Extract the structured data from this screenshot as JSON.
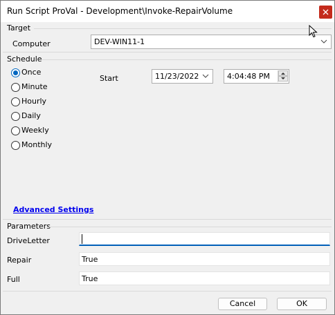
{
  "window": {
    "title": "Run Script ProVal - Development\\Invoke-RepairVolume",
    "close_glyph": "x"
  },
  "target": {
    "section_label": "Target",
    "computer_label": "Computer",
    "computer_value": "DEV-WIN11-1"
  },
  "schedule": {
    "section_label": "Schedule",
    "options": [
      "Once",
      "Minute",
      "Hourly",
      "Daily",
      "Weekly",
      "Monthly"
    ],
    "selected": "Once",
    "start_label": "Start",
    "start_date": "11/23/2022",
    "start_time": "4:04:48 PM"
  },
  "advanced_link": "Advanced Settings",
  "parameters": {
    "section_label": "Parameters",
    "fields": [
      {
        "label": "DriveLetter",
        "value": ""
      },
      {
        "label": "Repair",
        "value": "True"
      },
      {
        "label": "Full",
        "value": "True"
      }
    ]
  },
  "buttons": {
    "cancel": "Cancel",
    "ok": "OK"
  },
  "colors": {
    "accent": "#0067c0",
    "close": "#c42b1c",
    "link": "#0000ee"
  }
}
